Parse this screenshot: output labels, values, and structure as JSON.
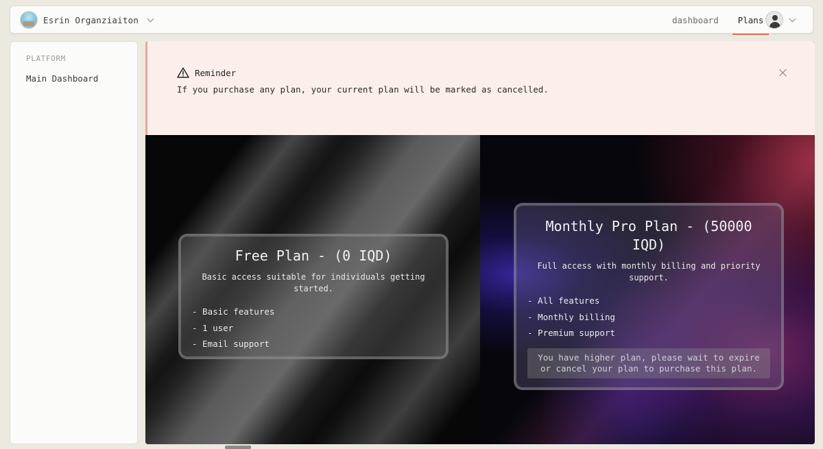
{
  "org": {
    "name": "Esrin Organziaiton"
  },
  "nav": [
    {
      "label": "dashboard",
      "active": false
    },
    {
      "label": "Plans",
      "active": true
    }
  ],
  "sidebar": {
    "section": "PLATFORM",
    "items": [
      {
        "label": "Main Dashboard"
      }
    ]
  },
  "alert": {
    "title": "Reminder",
    "message": "If you purchase any plan, your current plan will be marked as cancelled."
  },
  "plans": [
    {
      "title": "Free Plan - (0 IQD)",
      "description": "Basic access suitable for individuals getting started.",
      "features": [
        "- Basic features",
        "- 1 user",
        "- Email support"
      ]
    },
    {
      "title": "Monthly Pro Plan - (50000 IQD)",
      "description": "Full access with monthly billing and priority support.",
      "features": [
        "- All features",
        "- Monthly billing",
        "- Premium support"
      ],
      "note": "You have higher plan, please wait to expire or cancel your plan to purchase this plan."
    }
  ],
  "colors": {
    "accent": "#ec6a58",
    "alert_bg": "#fcefeb"
  }
}
